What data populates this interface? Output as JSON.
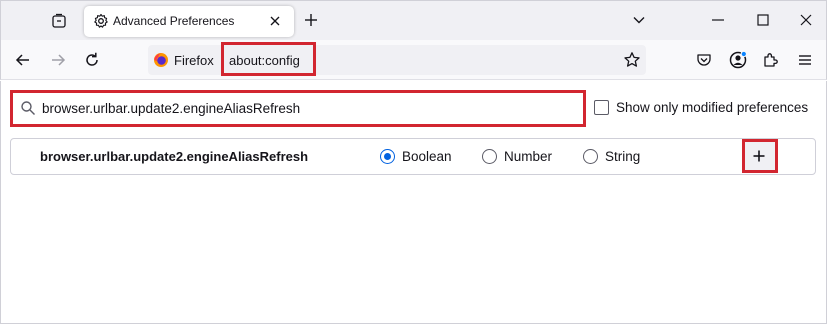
{
  "tab": {
    "title": "Advanced Preferences"
  },
  "urlbar": {
    "identity_label": "Firefox",
    "url": "about:config"
  },
  "search": {
    "value": "browser.urlbar.update2.engineAliasRefresh"
  },
  "filters": {
    "show_modified_label": "Show only modified preferences",
    "show_modified_checked": false
  },
  "preference": {
    "name": "browser.urlbar.update2.engineAliasRefresh",
    "types": [
      {
        "label": "Boolean",
        "selected": true
      },
      {
        "label": "Number",
        "selected": false
      },
      {
        "label": "String",
        "selected": false
      }
    ],
    "add_icon": "plus-icon"
  },
  "icons": {
    "tab": "gear-icon",
    "accent_color": "#0061e0",
    "highlight_color": "#d22630"
  }
}
